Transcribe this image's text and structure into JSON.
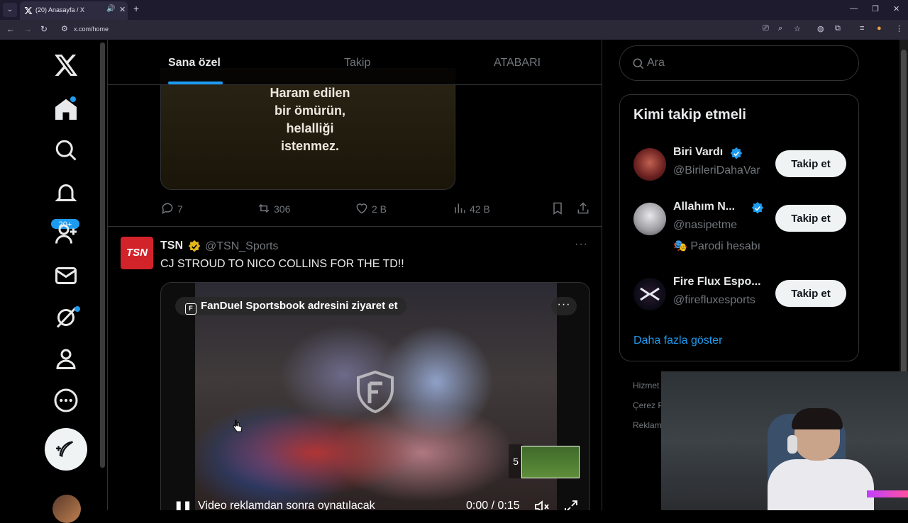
{
  "browser": {
    "tab_title": "(20) Anasayfa / X",
    "url": "x.com/home"
  },
  "nav": {
    "notifications_badge": "20+",
    "items": [
      "x-logo-icon",
      "home-icon",
      "explore-icon",
      "notifications-icon",
      "communities-icon",
      "messages-icon",
      "grok-icon",
      "profile-icon",
      "more-icon"
    ]
  },
  "timeline": {
    "tabs": [
      {
        "label": "Sana özel",
        "active": true
      },
      {
        "label": "Takip",
        "active": false
      },
      {
        "label": "ATABARI",
        "active": false
      }
    ],
    "prev_post": {
      "media_text": "Haram edilen\nbir ömürün,\nhelalliği\nistenmez.",
      "replies": "7",
      "reposts": "306",
      "likes": "2 B",
      "views": "42 B"
    },
    "post": {
      "avatar_text": "TSN",
      "author": "TSN",
      "handle": "@TSN_Sports",
      "text": "CJ STROUD TO NICO COLLINS FOR THE TD!!",
      "ad_pill": "FanDuel Sportsbook adresini ziyaret et",
      "countdown": "5",
      "video_caption": "Video reklamdan sonra oynatılacak",
      "video_time": "0:00 / 0:15"
    }
  },
  "right": {
    "search_placeholder": "Ara",
    "who_to_follow": {
      "title": "Kimi takip etmeli",
      "follow_label": "Takip et",
      "show_more": "Daha fazla göster",
      "suggestions": [
        {
          "name": "Biri Vardı",
          "handle": "@BirileriDahaVar",
          "verified": true,
          "note": ""
        },
        {
          "name": "Allahım N...",
          "handle": "@nasipetme",
          "verified": true,
          "note": "Parodi hesabı"
        },
        {
          "name": "Fire Flux Espo...",
          "handle": "@firefluxesports",
          "verified": false,
          "note": ""
        }
      ]
    },
    "footer": [
      "Hizmet",
      "Çerez P",
      "Reklam"
    ]
  },
  "colors": {
    "accent": "#1d9bf0",
    "background": "#000000",
    "text_primary": "#e7e9ea",
    "text_secondary": "#71767b",
    "tsn_red": "#d2232a",
    "gold_check": "#e2b719"
  }
}
